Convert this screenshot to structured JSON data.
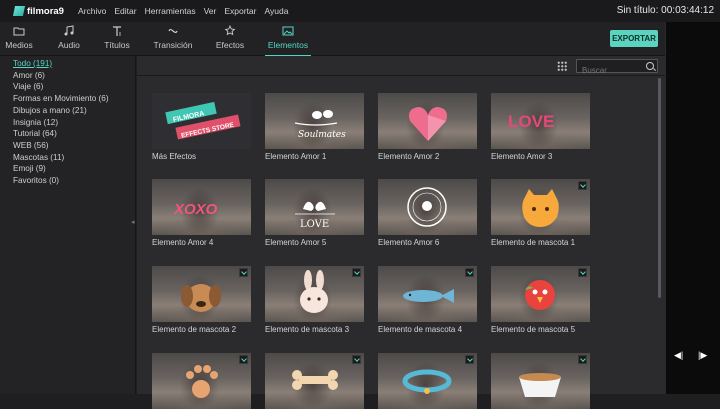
{
  "app": {
    "name": "filmora9",
    "project_title": "Sin título:",
    "timecode": "00:03:44:12"
  },
  "menu": [
    "Archivo",
    "Editar",
    "Herramientas",
    "Ver",
    "Exportar",
    "Ayuda"
  ],
  "tabs": [
    {
      "label": "Medios",
      "icon": "folder-icon"
    },
    {
      "label": "Audio",
      "icon": "music-note-icon"
    },
    {
      "label": "Títulos",
      "icon": "text-icon"
    },
    {
      "label": "Transición",
      "icon": "transition-icon"
    },
    {
      "label": "Efectos",
      "icon": "effects-icon"
    },
    {
      "label": "Elementos",
      "icon": "image-icon"
    }
  ],
  "active_tab": "Elementos",
  "export_label": "EXPORTAR",
  "search_placeholder": "Buscar",
  "categories": [
    "Todo (191)",
    "Amor (6)",
    "Viaje (6)",
    "Formas en Movimiento (6)",
    "Dibujos a mano (21)",
    "Insignia (12)",
    "Tutorial (64)",
    "WEB (56)",
    "Mascotas (11)",
    "Emoji (9)",
    "Favoritos (0)"
  ],
  "active_category": "Todo (191)",
  "tiles": [
    {
      "label": "Más Efectos",
      "thumb_text": [
        "FILMORA",
        "EFFECTS STORE"
      ]
    },
    {
      "label": "Elemento Amor 1",
      "thumb_text": [
        "Soulmates"
      ]
    },
    {
      "label": "Elemento Amor 2"
    },
    {
      "label": "Elemento Amor 3",
      "thumb_text": [
        "LOVE"
      ]
    },
    {
      "label": "Elemento Amor 4",
      "thumb_text": [
        "XOXO"
      ]
    },
    {
      "label": "Elemento Amor 5",
      "thumb_text": [
        "LOVE"
      ]
    },
    {
      "label": "Elemento Amor 6"
    },
    {
      "label": "Elemento de mascota 1",
      "download": true
    },
    {
      "label": "Elemento de mascota 2",
      "download": true
    },
    {
      "label": "Elemento de mascota 3",
      "download": true
    },
    {
      "label": "Elemento de mascota 4",
      "download": true
    },
    {
      "label": "Elemento de mascota 5",
      "download": true
    },
    {
      "label": "",
      "download": true
    },
    {
      "label": "",
      "download": true
    },
    {
      "label": "",
      "download": true
    },
    {
      "label": "",
      "download": true
    }
  ],
  "colors": {
    "accent": "#55d6c2",
    "background": "#1f1f22"
  }
}
